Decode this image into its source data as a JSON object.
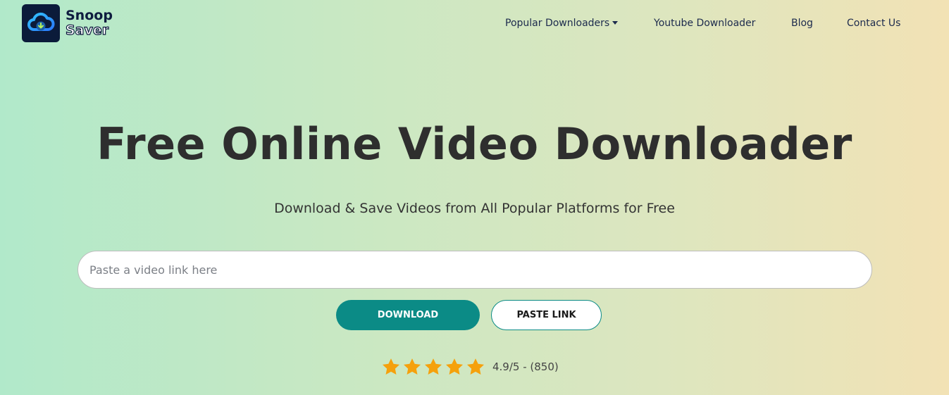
{
  "brand": {
    "line1": "Snoop",
    "line2": "Saver"
  },
  "nav": {
    "items": [
      {
        "label": "Popular Downloaders",
        "has_dropdown": true
      },
      {
        "label": "Youtube Downloader"
      },
      {
        "label": "Blog"
      },
      {
        "label": "Contact Us"
      }
    ]
  },
  "hero": {
    "title": "Free Online Video Downloader",
    "subtitle": "Download & Save Videos from All Popular Platforms for Free"
  },
  "search": {
    "placeholder": "Paste a video link here",
    "value": ""
  },
  "buttons": {
    "download": "DOWNLOAD",
    "paste": "PASTE LINK"
  },
  "rating": {
    "stars": 5,
    "score_text": "4.9/5 - (850)"
  },
  "colors": {
    "accent": "#0b8b86",
    "star": "#f5a10c",
    "logo_bg": "#0b1b3a",
    "nav_text": "#1c2a4d"
  }
}
